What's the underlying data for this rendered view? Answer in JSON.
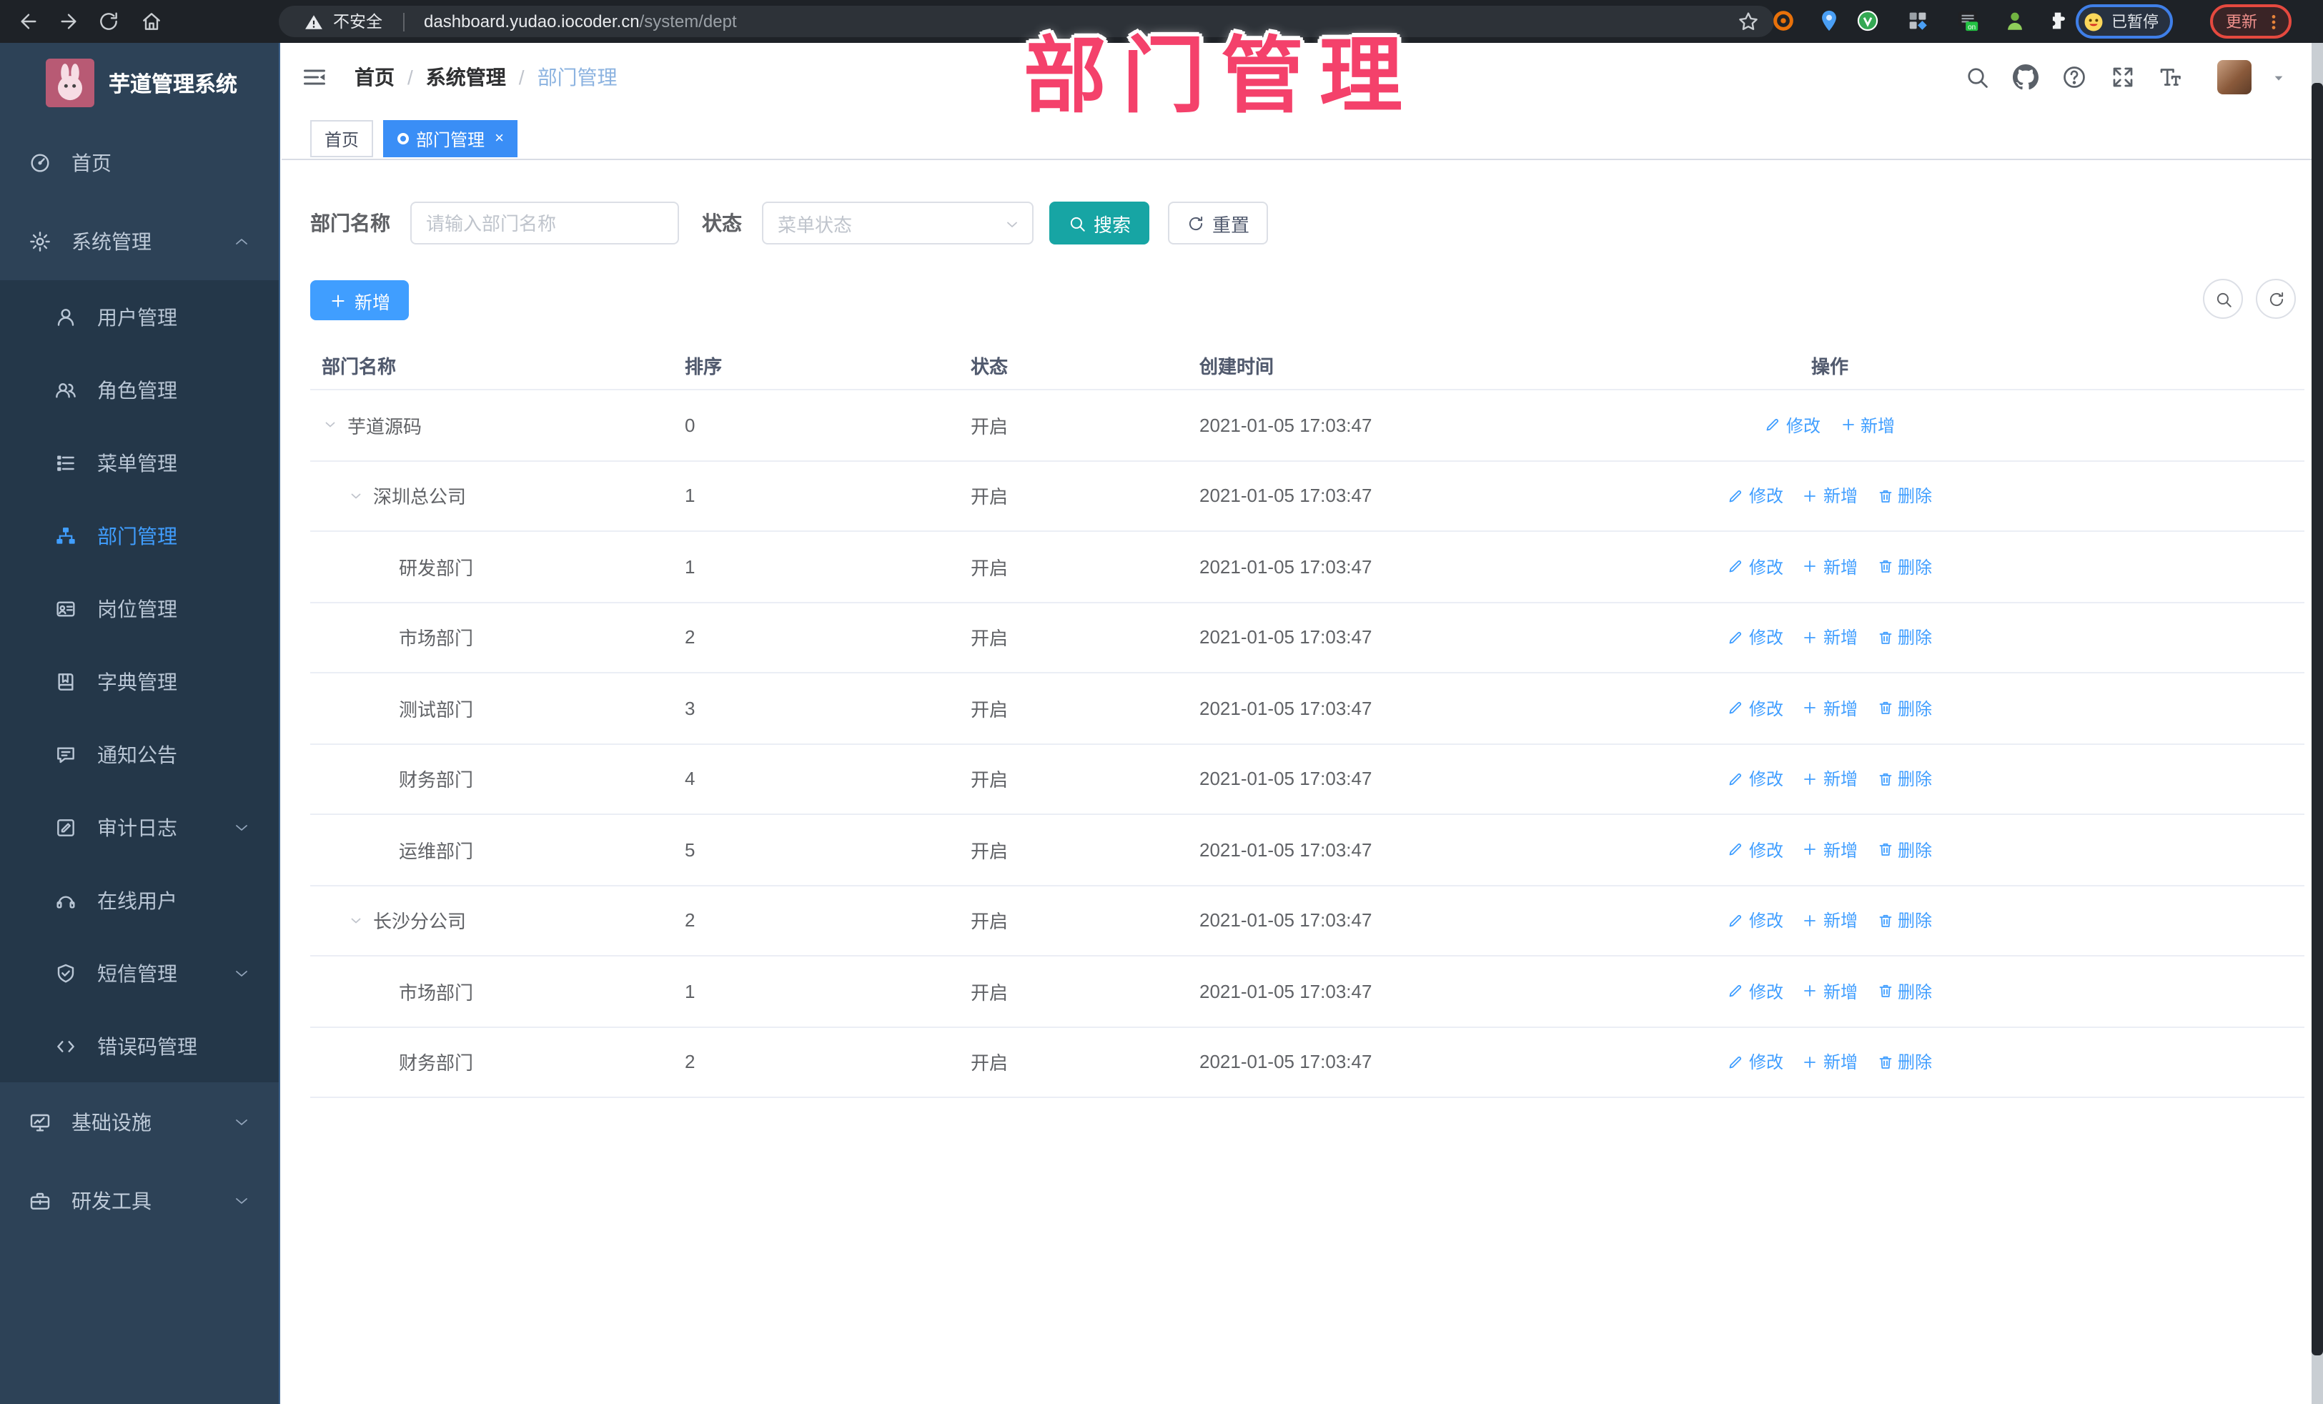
{
  "browser": {
    "security_label": "不安全",
    "url_host": "dashboard.yudao.iocoder.cn",
    "url_path": "/system/dept",
    "extensions": [
      "target-extension-icon",
      "pin-extension-icon",
      "green-check-extension-icon",
      "grid-extension-icon",
      "list-on-extension-icon",
      "person-extension-icon",
      "puzzle-extension-icon"
    ],
    "extension_badge": "on",
    "profile_status": "已暂停",
    "update_label": "更新"
  },
  "sidebar": {
    "app_title": "芋道管理系统",
    "items": [
      {
        "label": "首页",
        "icon": "dashboard-icon",
        "level": 0
      },
      {
        "label": "系统管理",
        "icon": "gear-icon",
        "level": 0,
        "chevron": "up"
      },
      {
        "label": "用户管理",
        "icon": "user-icon",
        "level": 1
      },
      {
        "label": "角色管理",
        "icon": "users-icon",
        "level": 1
      },
      {
        "label": "菜单管理",
        "icon": "menu-tree-icon",
        "level": 1
      },
      {
        "label": "部门管理",
        "icon": "org-tree-icon",
        "level": 1,
        "active": true
      },
      {
        "label": "岗位管理",
        "icon": "badge-icon",
        "level": 1
      },
      {
        "label": "字典管理",
        "icon": "book-icon",
        "level": 1
      },
      {
        "label": "通知公告",
        "icon": "announcement-icon",
        "level": 1
      },
      {
        "label": "审计日志",
        "icon": "log-icon",
        "level": 1,
        "chevron": "down"
      },
      {
        "label": "在线用户",
        "icon": "headset-icon",
        "level": 1
      },
      {
        "label": "短信管理",
        "icon": "sms-icon",
        "level": 1,
        "chevron": "down"
      },
      {
        "label": "错误码管理",
        "icon": "code-icon",
        "level": 1
      },
      {
        "label": "基础设施",
        "icon": "infra-icon",
        "level": 0,
        "chevron": "down"
      },
      {
        "label": "研发工具",
        "icon": "tools-icon",
        "level": 0,
        "chevron": "down"
      }
    ]
  },
  "header": {
    "breadcrumb": [
      "首页",
      "系统管理",
      "部门管理"
    ],
    "separator": "/"
  },
  "overlay_title": "部门管理",
  "tabs": [
    {
      "label": "首页",
      "active": false
    },
    {
      "label": "部门管理",
      "active": true,
      "closable": true
    }
  ],
  "filters": {
    "dept_name_label": "部门名称",
    "dept_name_placeholder": "请输入部门名称",
    "status_label": "状态",
    "status_placeholder": "菜单状态",
    "search_label": "搜索",
    "reset_label": "重置"
  },
  "toolbar": {
    "add_label": "新增"
  },
  "table": {
    "columns": [
      "部门名称",
      "排序",
      "状态",
      "创建时间",
      "操作"
    ],
    "rows": [
      {
        "name": "芋道源码",
        "level": 0,
        "expandable": true,
        "sort": "0",
        "status": "开启",
        "created": "2021-01-05 17:03:47",
        "actions": [
          "修改",
          "新增"
        ]
      },
      {
        "name": "深圳总公司",
        "level": 1,
        "expandable": true,
        "sort": "1",
        "status": "开启",
        "created": "2021-01-05 17:03:47",
        "actions": [
          "修改",
          "新增",
          "删除"
        ]
      },
      {
        "name": "研发部门",
        "level": 2,
        "expandable": false,
        "sort": "1",
        "status": "开启",
        "created": "2021-01-05 17:03:47",
        "actions": [
          "修改",
          "新增",
          "删除"
        ]
      },
      {
        "name": "市场部门",
        "level": 2,
        "expandable": false,
        "sort": "2",
        "status": "开启",
        "created": "2021-01-05 17:03:47",
        "actions": [
          "修改",
          "新增",
          "删除"
        ]
      },
      {
        "name": "测试部门",
        "level": 2,
        "expandable": false,
        "sort": "3",
        "status": "开启",
        "created": "2021-01-05 17:03:47",
        "actions": [
          "修改",
          "新增",
          "删除"
        ]
      },
      {
        "name": "财务部门",
        "level": 2,
        "expandable": false,
        "sort": "4",
        "status": "开启",
        "created": "2021-01-05 17:03:47",
        "actions": [
          "修改",
          "新增",
          "删除"
        ]
      },
      {
        "name": "运维部门",
        "level": 2,
        "expandable": false,
        "sort": "5",
        "status": "开启",
        "created": "2021-01-05 17:03:47",
        "actions": [
          "修改",
          "新增",
          "删除"
        ]
      },
      {
        "name": "长沙分公司",
        "level": 1,
        "expandable": true,
        "sort": "2",
        "status": "开启",
        "created": "2021-01-05 17:03:47",
        "actions": [
          "修改",
          "新增",
          "删除"
        ]
      },
      {
        "name": "市场部门",
        "level": 2,
        "expandable": false,
        "sort": "1",
        "status": "开启",
        "created": "2021-01-05 17:03:47",
        "actions": [
          "修改",
          "新增",
          "删除"
        ]
      },
      {
        "name": "财务部门",
        "level": 2,
        "expandable": false,
        "sort": "2",
        "status": "开启",
        "created": "2021-01-05 17:03:47",
        "actions": [
          "修改",
          "新增",
          "删除"
        ]
      }
    ]
  },
  "colors": {
    "primary_blue": "#409eff",
    "tab_active_blue": "#3a8ef6",
    "search_teal": "#17a5a4",
    "overlay_pink": "#f4416b",
    "sidebar_bg": "#2d4257",
    "submenu_bg": "#243749",
    "browser_bar_bg": "#1e2227",
    "status_text": "#606266"
  }
}
